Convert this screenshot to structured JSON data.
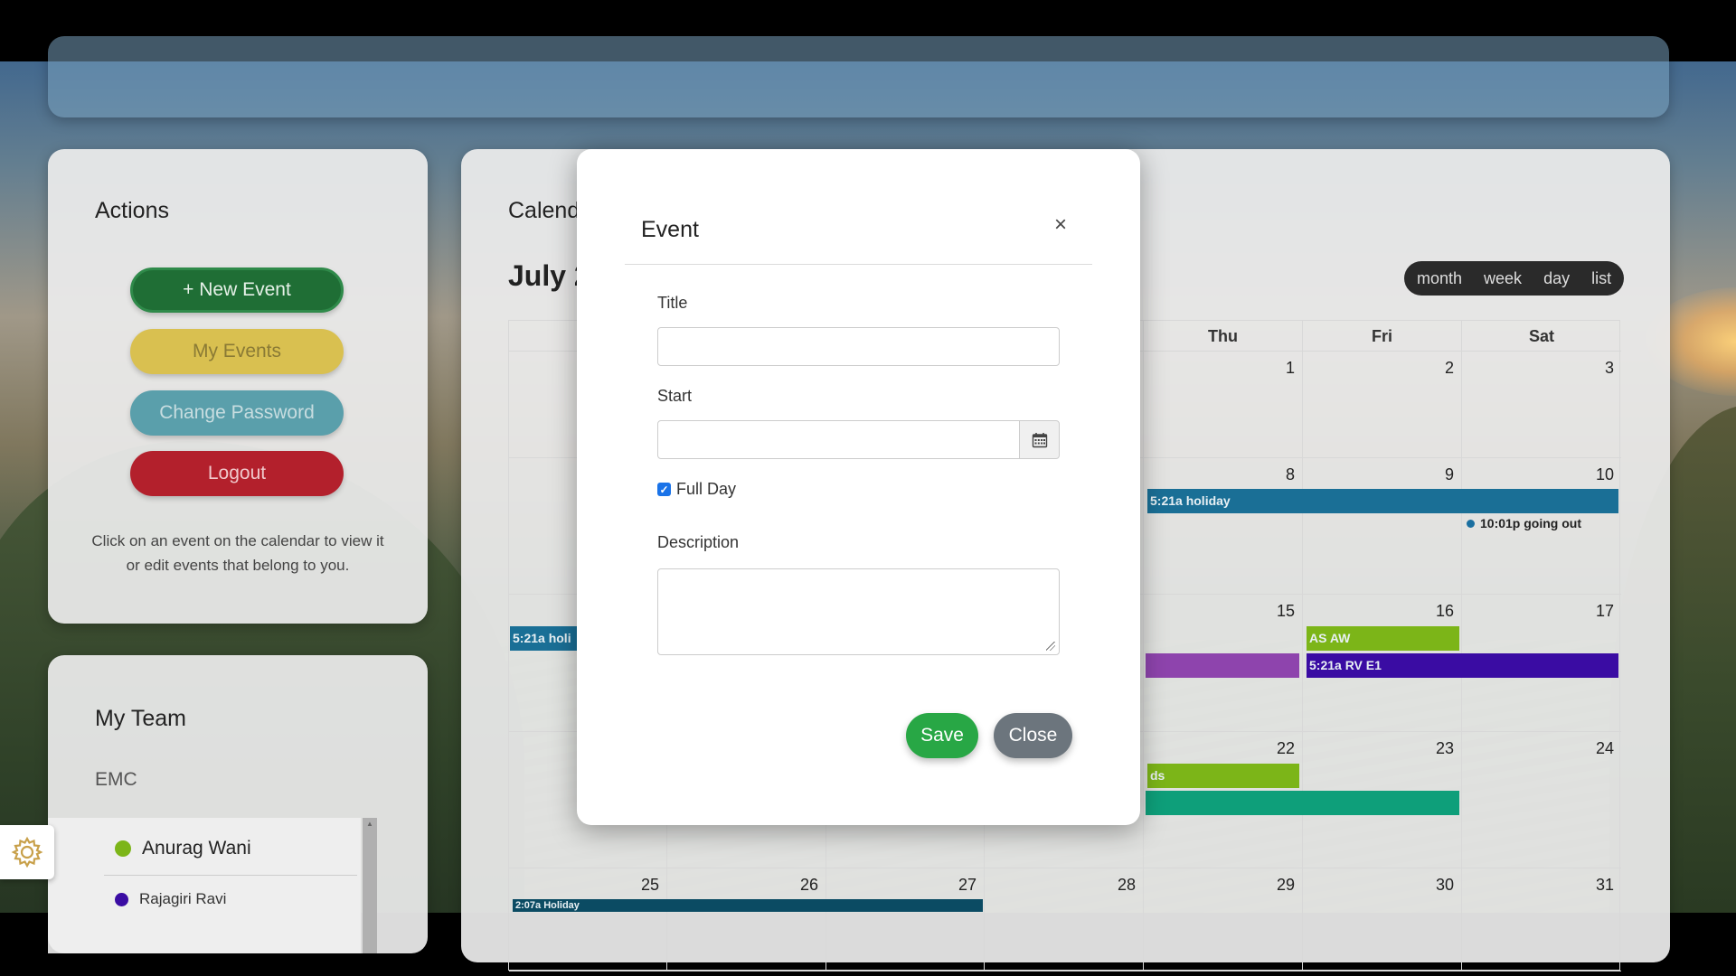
{
  "actions": {
    "title": "Actions",
    "new_event": "+ New Event",
    "my_events": "My Events",
    "change_password": "Change Password",
    "logout": "Logout",
    "help": "Click on an event on the calendar to view it or edit events that belong to you."
  },
  "team": {
    "title": "My Team",
    "group": "EMC",
    "members": [
      {
        "name": "Anurag Wani",
        "color": "#7cb518"
      },
      {
        "name": "Rajagiri Ravi",
        "color": "#3a0ca3"
      }
    ]
  },
  "calendar": {
    "heading": "Calendar",
    "month_label": "July 2",
    "views": [
      "month",
      "week",
      "day",
      "list"
    ],
    "day_headers": [
      "Thu",
      "Fri",
      "Sat"
    ],
    "weeks": [
      [
        "",
        "",
        "",
        "",
        "1",
        "2",
        "3"
      ],
      [
        "",
        "",
        "",
        "",
        "8",
        "9",
        "10"
      ],
      [
        "",
        "",
        "",
        "",
        "15",
        "16",
        "17"
      ],
      [
        "",
        "",
        "",
        "",
        "22",
        "23",
        "24"
      ],
      [
        "25",
        "26",
        "27",
        "28",
        "29",
        "30",
        "31"
      ]
    ],
    "events": {
      "holiday_w2": "5:21a holiday",
      "going_out": "10:01p going out",
      "holiday_w3": "5:21a holi",
      "as_aw": "AS AW",
      "rv_e1": "5:21a RV E1",
      "ds": "ds",
      "holiday_w5": "2:07a Holiday"
    },
    "colors": {
      "holiday": "#1a6f96",
      "green": "#7cb518",
      "purple": "#8e44ad",
      "indigo": "#3a0ca3",
      "teal": "#0e9f7a",
      "dark_teal": "#0b4b63"
    }
  },
  "modal": {
    "title": "Event",
    "close_glyph": "×",
    "title_label": "Title",
    "title_value": "",
    "start_label": "Start",
    "start_value": "",
    "full_day_label": "Full Day",
    "full_day_checked": true,
    "description_label": "Description",
    "description_value": "",
    "save": "Save",
    "close": "Close"
  },
  "icons": {
    "settings": "gear-icon",
    "calendar": "calendar-icon",
    "close": "close-icon"
  }
}
